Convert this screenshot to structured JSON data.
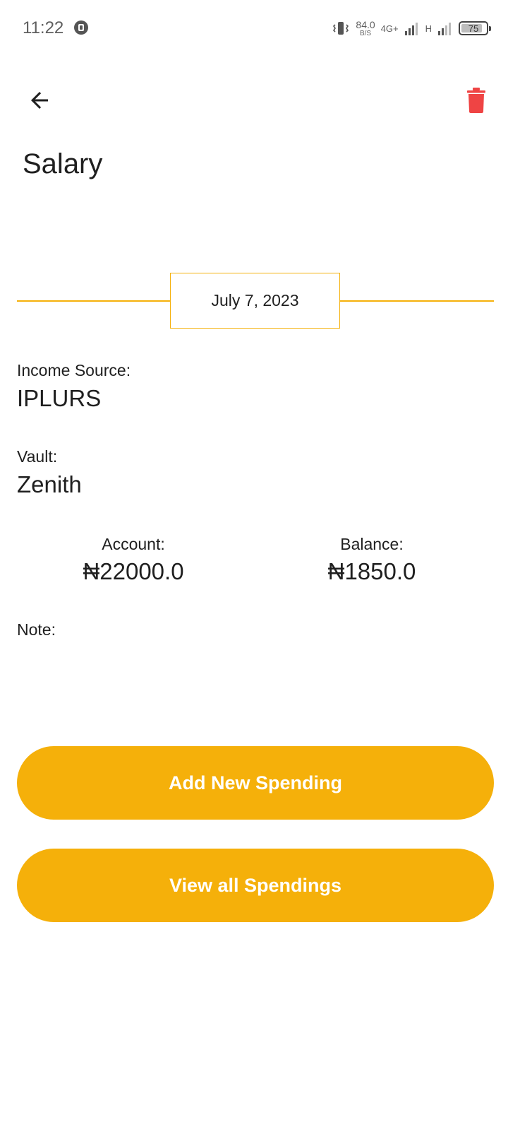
{
  "status_bar": {
    "time": "11:22",
    "net_speed_value": "84.0",
    "net_speed_unit": "B/S",
    "network_primary": "4G+",
    "network_secondary": "H",
    "battery_level": "75"
  },
  "header": {
    "title": "Salary"
  },
  "date": "July 7, 2023",
  "details": {
    "income_source_label": "Income Source:",
    "income_source_value": "IPLURS",
    "vault_label": "Vault:",
    "vault_value": "Zenith",
    "account_label": "Account:",
    "account_value": "₦22000.0",
    "balance_label": "Balance:",
    "balance_value": "₦1850.0",
    "note_label": "Note:"
  },
  "actions": {
    "add_spending_label": "Add New Spending",
    "view_spendings_label": "View all Spendings"
  },
  "colors": {
    "accent": "#f5b00a",
    "delete": "#ef4444"
  }
}
